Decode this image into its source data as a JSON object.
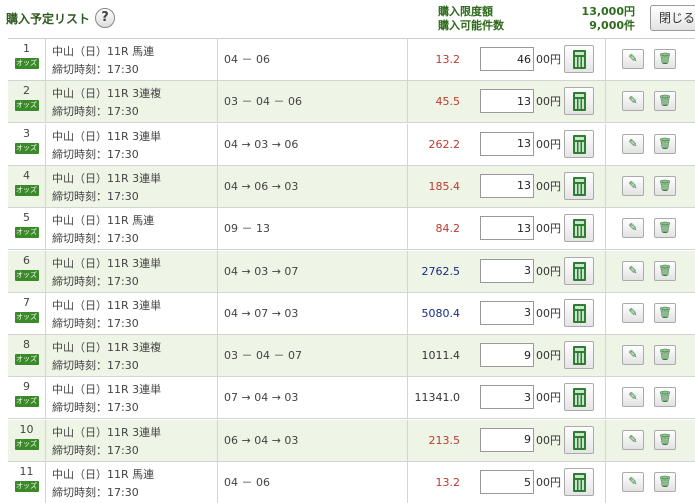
{
  "header": {
    "title": "購入予定リスト",
    "help_icon": "?",
    "limit_label": "購入限度額",
    "limit_value": "13,000円",
    "count_label": "購入可能件数",
    "count_value": "9,000件",
    "close_label": "閉じる"
  },
  "colors": {
    "accent_green": "#3b8a2a",
    "odds_red": "#c0392b",
    "odds_blue": "#1a2a80",
    "odds_black": "#333333",
    "row_alt_bg": "#eef5e7"
  },
  "odds_badge_label": "オッズ",
  "amount_unit": "00円",
  "icons": {
    "calculator": "calculator-icon",
    "edit": "edit-icon",
    "delete": "trash-icon"
  },
  "rows": [
    {
      "num": "1",
      "race": "中山（日）11R 馬連",
      "deadline": "締切時刻：17:30",
      "combo": "04 － 06",
      "odds": "13.2",
      "odds_color": "#c0392b",
      "amount": "46"
    },
    {
      "num": "2",
      "race": "中山（日）11R 3連複",
      "deadline": "締切時刻：17:30",
      "combo": "03 － 04 － 06",
      "odds": "45.5",
      "odds_color": "#c0392b",
      "amount": "13"
    },
    {
      "num": "3",
      "race": "中山（日）11R 3連単",
      "deadline": "締切時刻：17:30",
      "combo": "04 → 03 → 06",
      "odds": "262.2",
      "odds_color": "#c0392b",
      "amount": "13"
    },
    {
      "num": "4",
      "race": "中山（日）11R 3連単",
      "deadline": "締切時刻：17:30",
      "combo": "04 → 06 → 03",
      "odds": "185.4",
      "odds_color": "#c0392b",
      "amount": "13"
    },
    {
      "num": "5",
      "race": "中山（日）11R 馬連",
      "deadline": "締切時刻：17:30",
      "combo": "09 － 13",
      "odds": "84.2",
      "odds_color": "#c0392b",
      "amount": "13"
    },
    {
      "num": "6",
      "race": "中山（日）11R 3連単",
      "deadline": "締切時刻：17:30",
      "combo": "04 → 03 → 07",
      "odds": "2762.5",
      "odds_color": "#1a2a80",
      "amount": "3"
    },
    {
      "num": "7",
      "race": "中山（日）11R 3連単",
      "deadline": "締切時刻：17:30",
      "combo": "04 → 07 → 03",
      "odds": "5080.4",
      "odds_color": "#1a2a80",
      "amount": "3"
    },
    {
      "num": "8",
      "race": "中山（日）11R 3連複",
      "deadline": "締切時刻：17:30",
      "combo": "03 － 04 － 07",
      "odds": "1011.4",
      "odds_color": "#333333",
      "amount": "9"
    },
    {
      "num": "9",
      "race": "中山（日）11R 3連単",
      "deadline": "締切時刻：17:30",
      "combo": "07 → 04 → 03",
      "odds": "11341.0",
      "odds_color": "#333333",
      "amount": "3"
    },
    {
      "num": "10",
      "race": "中山（日）11R 3連単",
      "deadline": "締切時刻：17:30",
      "combo": "06 → 04 → 03",
      "odds": "213.5",
      "odds_color": "#c0392b",
      "amount": "9"
    },
    {
      "num": "11",
      "race": "中山（日）11R 馬連",
      "deadline": "締切時刻：17:30",
      "combo": "04 － 06",
      "odds": "13.2",
      "odds_color": "#c0392b",
      "amount": "5"
    }
  ]
}
